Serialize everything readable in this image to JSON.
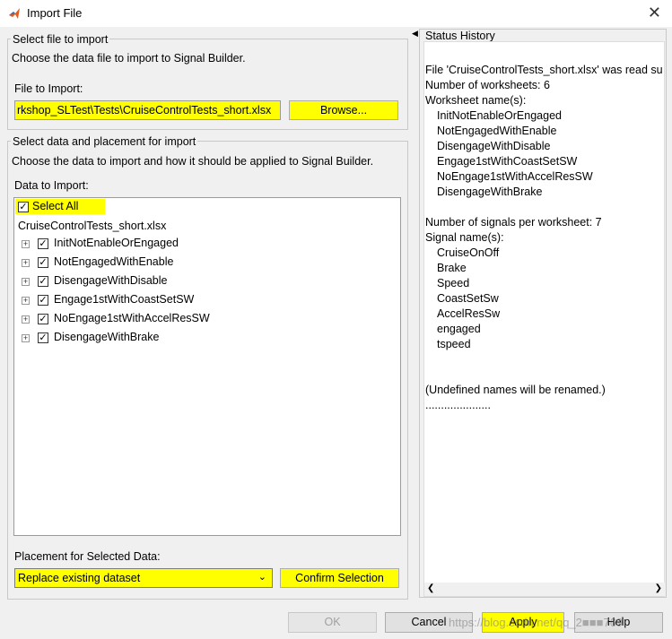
{
  "window": {
    "title": "Import File",
    "close_glyph": "✕"
  },
  "select_file": {
    "legend": "Select file to import",
    "description": "Choose the data file to import to Signal Builder.",
    "file_label": "File to Import:",
    "file_value": "rkshop_SLTest\\Tests\\CruiseControlTests_short.xlsx",
    "browse_label": "Browse..."
  },
  "select_data": {
    "legend": "Select data and placement for import",
    "description": "Choose the data to import and how it should be applied to Signal Builder.",
    "data_label": "Data to Import:",
    "select_all_label": "Select All",
    "file_node": "CruiseControlTests_short.xlsx",
    "items": [
      "InitNotEnableOrEngaged",
      "NotEngagedWithEnable",
      "DisengageWithDisable",
      "Engage1stWithCoastSetSW",
      "NoEngage1stWithAccelResSW",
      "DisengageWithBrake"
    ],
    "placement_label": "Placement for Selected Data:",
    "placement_value": "Replace existing dataset",
    "confirm_label": "Confirm Selection"
  },
  "status": {
    "legend": "Status History",
    "lines": [
      "File 'CruiseControlTests_short.xlsx' was read su",
      "Number of worksheets: 6",
      "Worksheet name(s):",
      "InitNotEnableOrEngaged",
      "NotEngagedWithEnable",
      "DisengageWithDisable",
      "Engage1stWithCoastSetSW",
      "NoEngage1stWithAccelResSW",
      "DisengageWithBrake",
      "",
      "Number of signals per worksheet: 7",
      "Signal name(s):",
      "CruiseOnOff",
      "Brake",
      "Speed",
      "CoastSetSw",
      "AccelResSw",
      "engaged",
      "tspeed",
      "",
      "",
      " (Undefined names will be renamed.)",
      "....................."
    ],
    "indented": [
      3,
      4,
      5,
      6,
      7,
      8,
      12,
      13,
      14,
      15,
      16,
      17,
      18
    ]
  },
  "footer": {
    "ok_label": "OK",
    "cancel_label": "Cancel",
    "apply_label": "Apply",
    "help_label": "Help",
    "watermark": "https://blog.csdn.net/qq_2■■■769"
  },
  "colors": {
    "highlight": "#ffff00",
    "matlab_icon": "#e55b1d"
  }
}
